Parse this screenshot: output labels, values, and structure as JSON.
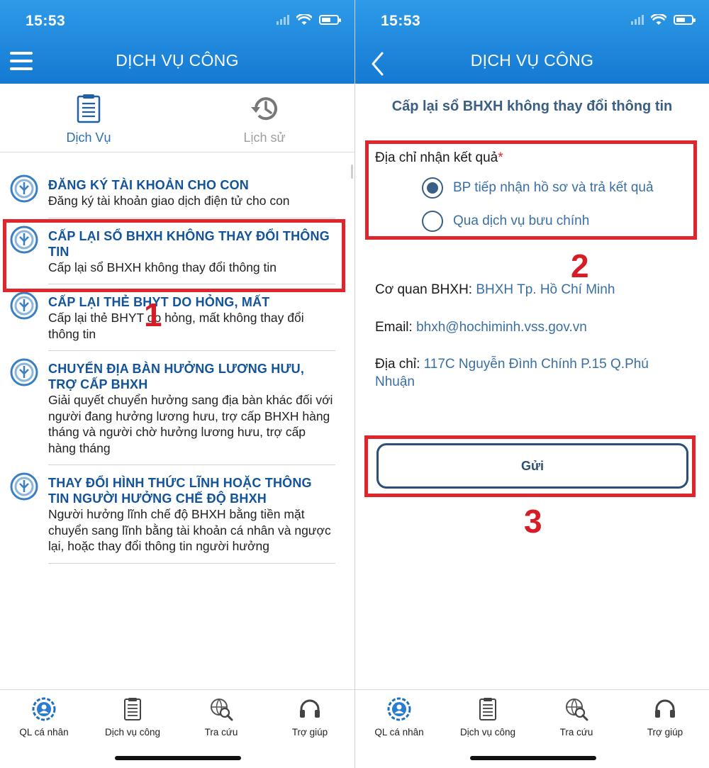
{
  "status_bar": {
    "time": "15:53"
  },
  "header": {
    "title": "DỊCH VỤ CÔNG"
  },
  "tabs": [
    {
      "label": "Dịch Vụ",
      "icon": "document-list-icon",
      "active": true
    },
    {
      "label": "Lịch sử",
      "icon": "history-icon",
      "active": false
    }
  ],
  "services": [
    {
      "title": "ĐĂNG KÝ TÀI KHOẢN CHO CON",
      "desc": "Đăng ký tài khoản giao dịch điện tử cho con"
    },
    {
      "title": "CẤP LẠI SỔ BHXH KHÔNG THAY ĐỔI THÔNG TIN",
      "desc": "Cấp lại sổ BHXH không thay đổi thông tin"
    },
    {
      "title": "CẤP LẠI THẺ BHYT DO HỎNG, MẤT",
      "desc": "Cấp lại thẻ BHYT do hỏng, mất không thay đổi thông tin"
    },
    {
      "title": "CHUYỂN ĐỊA BÀN HƯỞNG LƯƠNG HƯU, TRỢ CẤP BHXH",
      "desc": "Giải quyết chuyển hưởng sang địa bàn khác đối với người đang hưởng lương hưu, trợ cấp BHXH hàng tháng và người chờ hưởng lương hưu, trợ cấp hàng tháng"
    },
    {
      "title": "THAY ĐỔI HÌNH THỨC LĨNH HOẶC THÔNG TIN NGƯỜI HƯỞNG CHẾ ĐỘ BHXH",
      "desc": "Người hưởng lĩnh chế độ BHXH bằng tiền mặt chuyển sang lĩnh bằng tài khoản cá nhân và ngược lại, hoặc thay đổi thông tin người hưởng"
    }
  ],
  "form": {
    "title": "Cấp lại sổ BHXH không thay đổi thông tin",
    "address_label": "Địa chỉ nhận kết quả",
    "required_mark": "*",
    "options": [
      {
        "label": "BP tiếp nhận hồ sơ và trả kết quả",
        "selected": true
      },
      {
        "label": "Qua dịch vụ bưu chính",
        "selected": false
      }
    ],
    "agency_label": "Cơ quan BHXH:",
    "agency_value": "BHXH Tp. Hồ Chí Minh",
    "email_label": "Email:",
    "email_value": "bhxh@hochiminh.vss.gov.vn",
    "address_info_label": "Địa chỉ:",
    "address_info_value": "117C Nguyễn Đình Chính P.15 Q.Phú Nhuận",
    "submit_label": "Gửi"
  },
  "annotations": {
    "step1": "1",
    "step2": "2",
    "step3": "3"
  },
  "bottom_nav": [
    {
      "label": "QL cá nhân",
      "icon": "personal-gear-icon"
    },
    {
      "label": "Dịch vụ công",
      "icon": "document-list-icon"
    },
    {
      "label": "Tra cứu",
      "icon": "globe-search-icon"
    },
    {
      "label": "Trợ giúp",
      "icon": "headset-icon"
    }
  ],
  "colors": {
    "header": "#1a86dd",
    "accent": "#13539a",
    "annotation": "#e0262d"
  }
}
